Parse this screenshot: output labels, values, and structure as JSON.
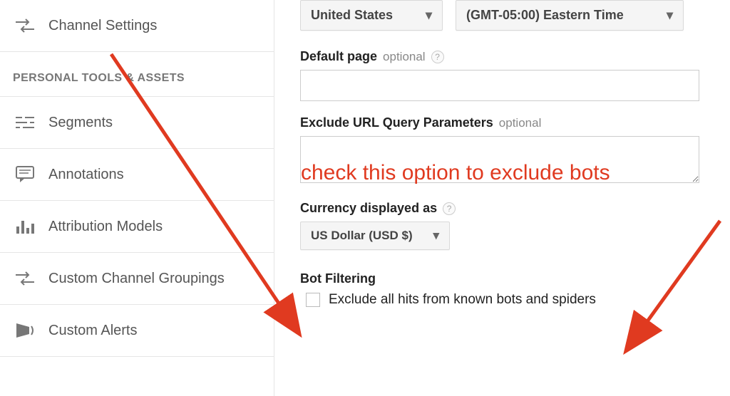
{
  "sidebar": {
    "items": [
      {
        "label": "Channel Settings"
      }
    ],
    "section_header": "PERSONAL TOOLS & ASSETS",
    "tools": [
      {
        "label": "Segments"
      },
      {
        "label": "Annotations"
      },
      {
        "label": "Attribution Models"
      },
      {
        "label": "Custom Channel Groupings"
      },
      {
        "label": "Custom Alerts"
      }
    ]
  },
  "main": {
    "country_dropdown": "United States",
    "timezone_dropdown": "(GMT-05:00) Eastern Time",
    "default_page_label": "Default page",
    "optional_text": "optional",
    "default_page_value": "",
    "exclude_url_label": "Exclude URL Query Parameters",
    "exclude_url_value": "",
    "currency_label": "Currency displayed as",
    "currency_dropdown": "US Dollar (USD $)",
    "bot_filtering_label": "Bot Filtering",
    "bot_filtering_checkbox_label": "Exclude all hits from known bots and spiders"
  },
  "annotation": {
    "text": "check this option to exclude bots",
    "color": "#e03a20"
  }
}
